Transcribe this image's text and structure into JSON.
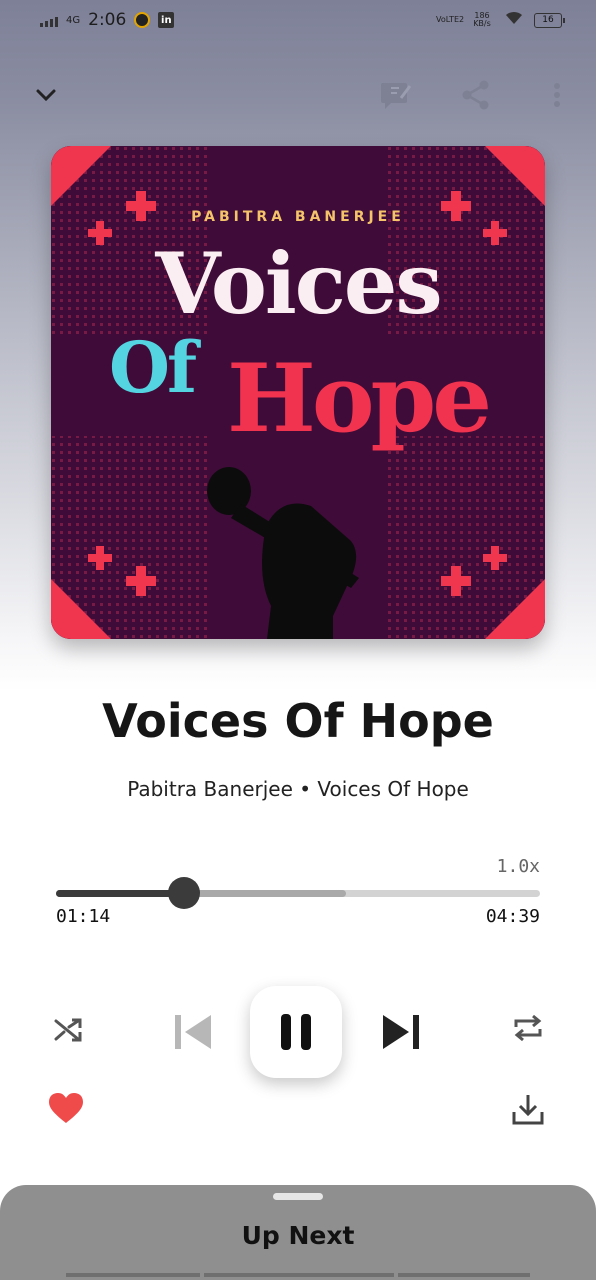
{
  "status_bar": {
    "network": "4G",
    "time": "2:06",
    "volte": "VoLTE2",
    "data_speed": "186 KB/s",
    "battery": "16"
  },
  "album_art": {
    "artist_text": "PABITRA BANERJEE",
    "line1": "Voices",
    "line2": "Of",
    "line3": "Hope"
  },
  "track": {
    "title": "Voices Of Hope",
    "subtitle": "Pabitra Banerjee • Voices Of Hope",
    "speed": "1.0x",
    "current_time": "01:14",
    "total_time": "04:39",
    "progress": 0.265,
    "buffered": 0.6
  },
  "controls": {
    "state": "playing",
    "liked": true
  },
  "up_next": {
    "label": "Up Next"
  },
  "colors": {
    "accent_heart": "#f04b4b",
    "progress_played": "#3b3b3b",
    "art_background": "#3f0b3a"
  }
}
